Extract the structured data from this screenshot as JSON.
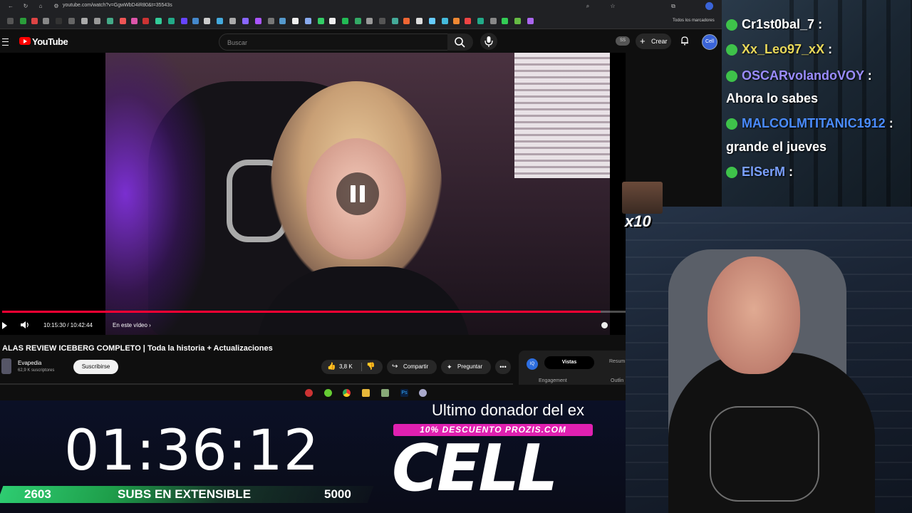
{
  "browser": {
    "url": "youtube.com/watch?v=GgwWbD4iR80&t=35543s",
    "bookmarks_folder": "Todos los marcadores"
  },
  "youtube": {
    "logo_text": "YouTube",
    "search_placeholder": "Buscar",
    "badge": "SS",
    "create_label": "Crear",
    "avatar_text": "Cell"
  },
  "player": {
    "current_time": "10:15:30 / 10:42:44",
    "chapter_label": "En este vídeo",
    "progress_fraction": 0.96,
    "state": "paused"
  },
  "video": {
    "title": "ALAS REVIEW ICEBERG COMPLETO | Toda la historia + Actualizaciones",
    "channel_name": "Evapedia",
    "subscribers": "62,9 K suscriptores",
    "subscribe_label": "Suscribirse",
    "likes": "3,8 K",
    "share_label": "Compartir",
    "ask_label": "Preguntar"
  },
  "side_panel": {
    "icon_text": "IQ",
    "tab_active": "Vistas",
    "tab_other": "Resum",
    "label_left": "Engagement",
    "label_right": "Outlin"
  },
  "chat": [
    {
      "user": "Cr1st0bal_7",
      "suffix": " :",
      "color": "#ffffff"
    },
    {
      "user": "Xx_Leo97_xX",
      "suffix": " :",
      "color": "#e8d85a"
    },
    {
      "user": "OSCARvolandoVOY",
      "suffix": " :",
      "color": "#9a8cff"
    },
    {
      "user": "",
      "suffix": "Ahora lo sabes",
      "color": "#ffffff"
    },
    {
      "user": "MALCOLMTITANIC1912",
      "suffix": " :",
      "color": "#4a8cff"
    },
    {
      "user": "",
      "suffix": "grande el jueves",
      "color": "#ffffff"
    },
    {
      "user": "ElSerM",
      "suffix": " :",
      "color": "#7aa0ff"
    }
  ],
  "emote": {
    "multiplier": "x10"
  },
  "overlay": {
    "timer": "01:36:12",
    "subs_current": "2603",
    "subs_label": "SUBS EN EXTENSIBLE",
    "subs_goal": "5000",
    "donor_title": "Ultimo donador del ex",
    "promo": "10% DESCUENTO PROZIS.COM",
    "donor_name": "CELL"
  },
  "colors": {
    "youtube_red": "#ff0000",
    "progress_red": "#ff0033",
    "subs_green": "#2ecc71",
    "promo_pink": "#e020b0"
  }
}
